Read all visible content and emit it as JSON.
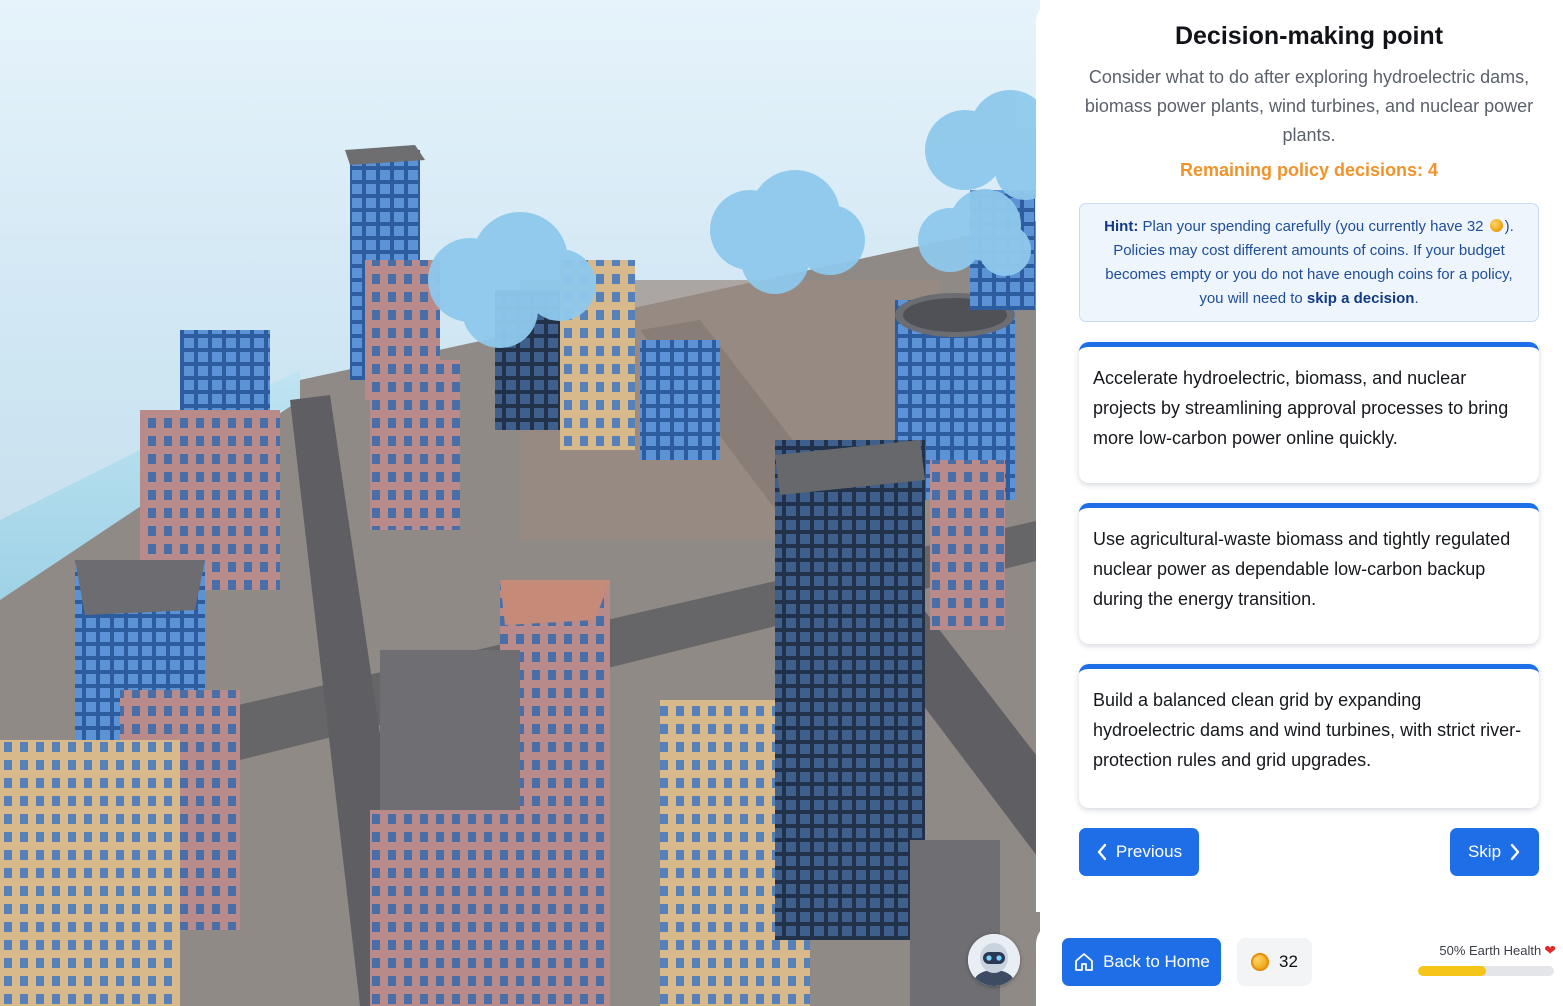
{
  "panel": {
    "title": "Decision-making point",
    "description": "Consider what to do after exploring hydroelectric dams, biomass power plants, wind turbines, and nuclear power plants.",
    "remaining": "Remaining policy decisions: 4",
    "hint": {
      "label": "Hint:",
      "text_before_coin": " Plan your spending carefully (you currently have 32 ",
      "text_after_coin": "). Policies may cost different amounts of coins. If your budget becomes empty or you do not have enough coins for a policy, you will need to ",
      "emphasis": "skip a decision",
      "end": "."
    },
    "options": [
      "Accelerate hydroelectric, biomass, and nuclear projects by streamlining approval processes to bring more low-carbon power online quickly.",
      "Use agricultural-waste biomass and tightly regulated nuclear power as dependable low-carbon backup during the energy transition.",
      "Build a balanced clean grid by expanding hydroelectric dams and wind turbines, with strict river-protection rules and grid upgrades."
    ],
    "previous_label": "Previous",
    "skip_label": "Skip"
  },
  "bottom": {
    "home_label": "Back to Home",
    "coins": "32",
    "health_label": "50% Earth Health",
    "health_fraction": 0.5
  },
  "icons": {
    "home": "home-icon",
    "coin": "coin-icon",
    "heart": "heart-icon",
    "chevron_left": "chevron-left-icon",
    "chevron_right": "chevron-right-icon",
    "avatar": "robot-avatar-icon"
  },
  "colors": {
    "accent": "#1e6ee8",
    "remaining": "#f0932b",
    "health_fill": "#f5c518",
    "hint_bg": "#eef5fd"
  }
}
